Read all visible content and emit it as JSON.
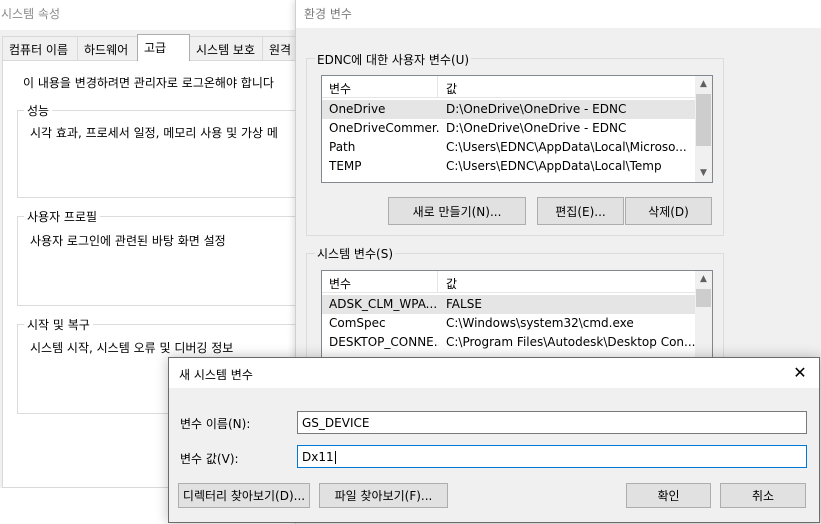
{
  "system_properties": {
    "title": "시스템 속성",
    "tabs": [
      "컴퓨터 이름",
      "하드웨어",
      "고급",
      "시스템 보호",
      "원격"
    ],
    "active_tab": "고급",
    "admin_note": "이 내용을 변경하려면 관리자로 로그온해야 합니다",
    "groups": [
      {
        "label": "성능",
        "description": "시각 효과, 프로세서 일정, 메모리 사용 및 가상 메"
      },
      {
        "label": "사용자 프로필",
        "description": "사용자 로그인에 관련된 바탕 화면 설정"
      },
      {
        "label": "시작 및 복구",
        "description": "시스템 시작, 시스템 오류 및 디버깅 정보"
      }
    ]
  },
  "environment_variables": {
    "title": "환경 변수",
    "user_section": {
      "label": "EDNC에 대한 사용자 변수(U)",
      "columns": [
        "변수",
        "값"
      ],
      "rows": [
        {
          "name": "OneDrive",
          "value": "D:\\OneDrive\\OneDrive - EDNC"
        },
        {
          "name": "OneDriveCommer...",
          "value": "D:\\OneDrive\\OneDrive - EDNC"
        },
        {
          "name": "Path",
          "value": "C:\\Users\\EDNC\\AppData\\Local\\Microso..."
        },
        {
          "name": "TEMP",
          "value": "C:\\Users\\EDNC\\AppData\\Local\\Temp"
        }
      ],
      "buttons": {
        "new": "새로 만들기(N)...",
        "edit": "편집(E)...",
        "delete": "삭제(D)"
      }
    },
    "system_section": {
      "label": "시스템 변수(S)",
      "columns": [
        "변수",
        "값"
      ],
      "rows": [
        {
          "name": "ADSK_CLM_WPA...",
          "value": "FALSE"
        },
        {
          "name": "ComSpec",
          "value": "C:\\Windows\\system32\\cmd.exe"
        },
        {
          "name": "DESKTOP_CONNE...",
          "value": "C:\\Program Files\\Autodesk\\Desktop Con..."
        }
      ]
    }
  },
  "new_system_variable": {
    "title": "새 시스템 변수",
    "name_label": "변수 이름(N):",
    "name_value": "GS_DEVICE",
    "value_label": "변수 값(V):",
    "value_value": "Dx11",
    "buttons": {
      "browse_dir": "디렉터리 찾아보기(D)...",
      "browse_file": "파일 찾아보기(F)...",
      "ok": "확인",
      "cancel": "취소"
    }
  },
  "colors": {
    "selection": "#e5e5e5",
    "focus_border": "#0078d7",
    "dialog_bg": "#f0f0f0"
  }
}
